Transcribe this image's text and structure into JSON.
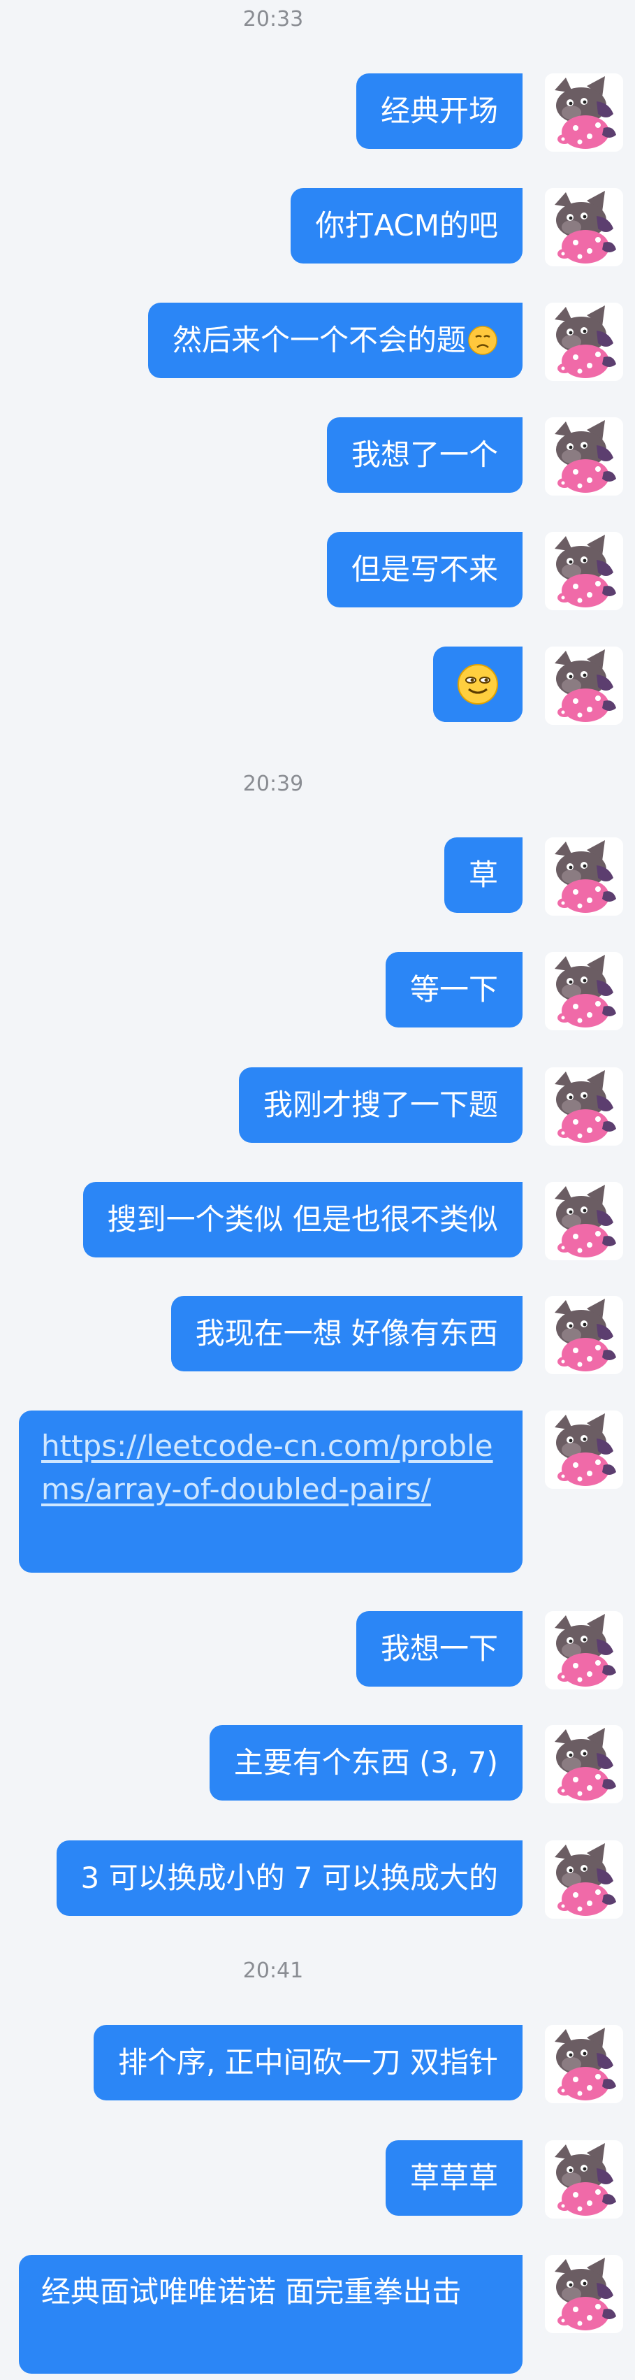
{
  "timestamps": [
    "20:33",
    "20:39",
    "20:41"
  ],
  "messages": [
    {
      "text": "经典开场"
    },
    {
      "text": "你打ACM的吧"
    },
    {
      "text": "然后来个一个不会的题",
      "emoji": "frowning-face-icon"
    },
    {
      "text": "我想了一个"
    },
    {
      "text": "但是写不来"
    },
    {
      "text": "",
      "emoji": "grinning-face-icon"
    },
    {
      "text": "草"
    },
    {
      "text": "等一下"
    },
    {
      "text": "我刚才搜了一下题"
    },
    {
      "text": "搜到一个类似 但是也很不类似"
    },
    {
      "text": "我现在一想 好像有东西"
    },
    {
      "text": "https://leetcode-cn.com/problems/array-of-doubled-pairs/",
      "is_link": true
    },
    {
      "text": "我想一下"
    },
    {
      "text": "主要有个东西 (3, 7)"
    },
    {
      "text": "3 可以换成小的 7 可以换成大的"
    },
    {
      "text": "排个序, 正中间砍一刀 双指针"
    },
    {
      "text": "草草草"
    },
    {
      "text": "经典面试唯唯诺诺 面完重拳出击"
    }
  ],
  "avatar": {
    "icon": "cartoon-dog-avatar-icon",
    "color_body": "#6b5d63",
    "color_pink": "#f06aa8"
  },
  "colors": {
    "bubble": "#2b86f6",
    "background": "#f3f5f8",
    "timestamp": "#8a8d93"
  }
}
